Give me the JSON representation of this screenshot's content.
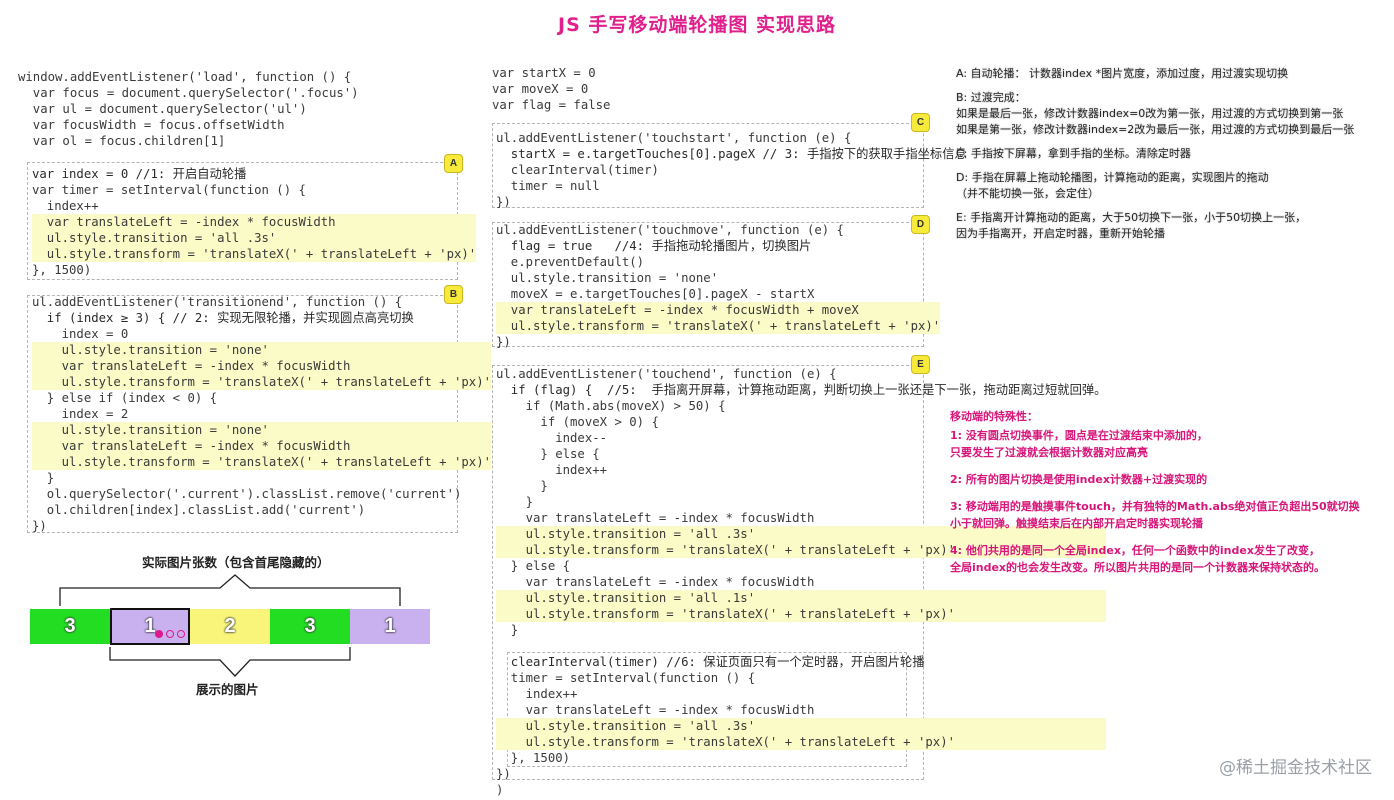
{
  "title": "JS 手写移动端轮播图 实现思路",
  "code": {
    "block_top": [
      "window.addEventListener('load', function () {",
      "  var focus = document.querySelector('.focus')",
      "  var ul = document.querySelector('ul')",
      "  var focusWidth = focus.offsetWidth",
      "  var ol = focus.children[1]"
    ],
    "block_a": [
      "var index = 0 //1: 开启自动轮播",
      "var timer = setInterval(function () {",
      "  index++",
      "  var translateLeft = -index * focusWidth",
      "  ul.style.transition = 'all .3s'",
      "  ul.style.transform = 'translateX(' + translateLeft + 'px)'",
      "}, 1500)"
    ],
    "block_b": [
      "ul.addEventListener('transitionend', function () {",
      "  if (index ≥ 3) { // 2: 实现无限轮播，并实现圆点高亮切换",
      "    index = 0",
      "    ul.style.transition = 'none'",
      "    var translateLeft = -index * focusWidth",
      "    ul.style.transform = 'translateX(' + translateLeft + 'px)'",
      "  } else if (index < 0) {",
      "    index = 2",
      "    ul.style.transition = 'none'",
      "    var translateLeft = -index * focusWidth",
      "    ul.style.transform = 'translateX(' + translateLeft + 'px)'",
      "  }",
      "  ol.querySelector('.current').classList.remove('current')",
      "  ol.children[index].classList.add('current')",
      "})"
    ],
    "block_vars": [
      "var startX = 0",
      "var moveX = 0",
      "var flag = false"
    ],
    "block_c": [
      "ul.addEventListener('touchstart', function (e) {",
      "  startX = e.targetTouches[0].pageX // 3: 手指按下的获取手指坐标信息",
      "  clearInterval(timer)",
      "  timer = null",
      "})"
    ],
    "block_d": [
      "ul.addEventListener('touchmove', function (e) {",
      "  flag = true   //4: 手指拖动轮播图片，切换图片",
      "  e.preventDefault()",
      "  ul.style.transition = 'none'",
      "  moveX = e.targetTouches[0].pageX - startX",
      "  var translateLeft = -index * focusWidth + moveX",
      "  ul.style.transform = 'translateX(' + translateLeft + 'px)'",
      "})"
    ],
    "block_e": [
      "ul.addEventListener('touchend', function (e) {",
      "  if (flag) {  //5:  手指离开屏幕，计算拖动距离，判断切换上一张还是下一张，拖动距离过短就回弹。",
      "    if (Math.abs(moveX) > 50) {",
      "      if (moveX > 0) {",
      "        index--",
      "      } else {",
      "        index++",
      "      }",
      "    }",
      "    var translateLeft = -index * focusWidth",
      "    ul.style.transition = 'all .3s'",
      "    ul.style.transform = 'translateX(' + translateLeft + 'px)'",
      "  } else {",
      "    var translateLeft = -index * focusWidth",
      "    ul.style.transition = 'all .1s'",
      "    ul.style.transform = 'translateX(' + translateLeft + 'px)'",
      "  }",
      "",
      "  clearInterval(timer) //6: 保证页面只有一个定时器，开启图片轮播",
      "  timer = setInterval(function () {",
      "    index++",
      "    var translateLeft = -index * focusWidth",
      "    ul.style.transition = 'all .3s'",
      "    ul.style.transform = 'translateX(' + translateLeft + 'px)'",
      "  }, 1500)",
      "})",
      ")"
    ]
  },
  "badges": [
    "A",
    "B",
    "C",
    "D",
    "E"
  ],
  "notes": [
    "A: 自动轮播：  计数器index *图片宽度，添加过度，用过渡实现切换",
    "B: 过渡完成：\n如果是最后一张，修改计数器index=0改为第一张，用过渡的方式切换到第一张\n如果是第一张，修改计数器index=2改为最后一张，用过渡的方式切换到最后一张",
    "C: 手指按下屏幕，拿到手指的坐标。清除定时器",
    "D:  手指在屏幕上拖动轮播图，计算拖动的距离，实现图片的拖动\n（并不能切换一张，会定住）",
    "E:  手指离开计算拖动的距离，大于50切换下一张，小于50切换上一张，\n因为手指离开，开启定时器，重新开始轮播"
  ],
  "special": {
    "heading": "移动端的特殊性：",
    "items": [
      "1:  没有圆点切换事件，圆点是在过渡结束中添加的，\n只要发生了过渡就会根据计数器对应高亮",
      "2:  所有的图片切换是使用index计数器+过渡实现的",
      "3:  移动端用的是触摸事件touch，并有独特的Math.abs绝对值正负超出50就切换\n小于就回弹。触摸结束后在内部开启定时器实现轮播",
      "4:  他们共用的是同一个全局index，任何一个函数中的index发生了改变，\n全局index的也会发生改变。所以图片共用的是同一个计数器来保持状态的。"
    ]
  },
  "diagram": {
    "top_label": "实际图片张数（包含首尾隐藏的）",
    "bottom_label": "展示的图片",
    "cells": [
      {
        "label": "3",
        "color": "#22dd22"
      },
      {
        "label": "1",
        "color": "#c9b0ef"
      },
      {
        "label": "2",
        "color": "#f8f57a"
      },
      {
        "label": "3",
        "color": "#22dd22"
      },
      {
        "label": "1",
        "color": "#c9b0ef"
      }
    ],
    "dots_color": "#e01a8c"
  },
  "watermark": "@稀土掘金技术社区"
}
